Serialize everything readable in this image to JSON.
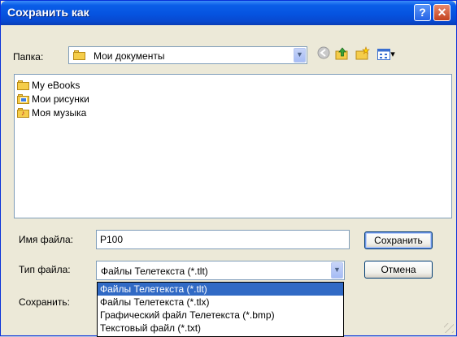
{
  "dialog": {
    "title": "Сохранить как",
    "help_glyph": "?",
    "close_glyph": "✕"
  },
  "lookin": {
    "label": "Папка:",
    "value": "Мои документы",
    "arrow": "▼"
  },
  "toolbar": {
    "back_icon": "back-icon",
    "up_icon": "up-folder-icon",
    "new_folder_icon": "new-folder-icon",
    "views_icon": "views-menu-icon",
    "views_glyph": "▾"
  },
  "files": [
    {
      "name": "My eBooks",
      "icon": "folder"
    },
    {
      "name": "Мои рисунки",
      "icon": "pictures-folder"
    },
    {
      "name": "Моя музыка",
      "icon": "music-folder"
    }
  ],
  "filename": {
    "label": "Имя файла:",
    "value": "P100"
  },
  "filetype": {
    "label": "Тип файла:",
    "value": "Файлы Телетекста (*.tlt)",
    "arrow": "▼",
    "options": [
      "Файлы Телетекста (*.tlt)",
      "Файлы Телетекста (*.tlx)",
      "Графический файл Телетекста (*.bmp)",
      "Текстовый файл (*.txt)"
    ],
    "selected_index": 0
  },
  "save_option": {
    "label": "Сохранить:"
  },
  "buttons": {
    "save": "Сохранить",
    "cancel": "Отмена"
  }
}
